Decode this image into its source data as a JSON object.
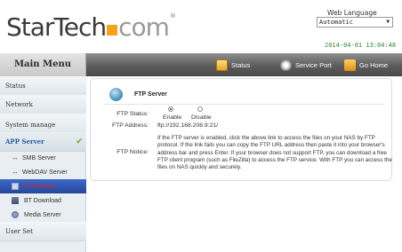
{
  "header": {
    "logo": {
      "star": "Star",
      "tech": "Tech",
      "com": "com",
      "reg": "®"
    },
    "language_label": "Web Language",
    "language_selected": "Automatic",
    "datetime": "2014-04-01 13:04:48"
  },
  "nav": {
    "menu_title": "Main Menu",
    "items": [
      {
        "label": "Status",
        "icon": "status-icon"
      },
      {
        "label": "Service Port",
        "icon": "gear-icon"
      },
      {
        "label": "Go Home",
        "icon": "home-icon"
      }
    ]
  },
  "sidebar": {
    "groups": [
      {
        "label": "Status"
      },
      {
        "label": "Network"
      },
      {
        "label": "System manage"
      },
      {
        "label": "APP Server"
      },
      {
        "label": "User Set"
      }
    ],
    "app_items": [
      {
        "label": "SMB Server",
        "icon": "smb-icon"
      },
      {
        "label": "WebDAV Server",
        "icon": "webdav-icon"
      },
      {
        "label": "FTP Server",
        "icon": "ftp-icon"
      },
      {
        "label": "BT Download",
        "icon": "bt-icon"
      },
      {
        "label": "Media Server",
        "icon": "media-icon"
      }
    ]
  },
  "panel": {
    "title": "FTP Server",
    "status_label": "FTP Status:",
    "status_options": [
      "Enable",
      "Disable"
    ],
    "status_selected": "Enable",
    "address_label": "FTP Address:",
    "address_value": "ftp://192.168.208.9:21/",
    "notice_label": "FTP Notice:",
    "notice_text": "If the FTP server is enabled, click the above link to access the files on your NAS by FTP protocol. If the link fails you can copy the FTP URL address then paste it into your browser's address bar and press Enter. If your browser does not support FTP, you can download a free FTP client program (such as FileZilla) to access the FTP service. With FTP you can access the files on NAS quickly and securely."
  },
  "colors": {
    "logo_accent": "#f6a31b",
    "datetime": "#2f8a2f",
    "selected_item_bg": "#26469b",
    "selected_item_text": "#dd2222"
  }
}
